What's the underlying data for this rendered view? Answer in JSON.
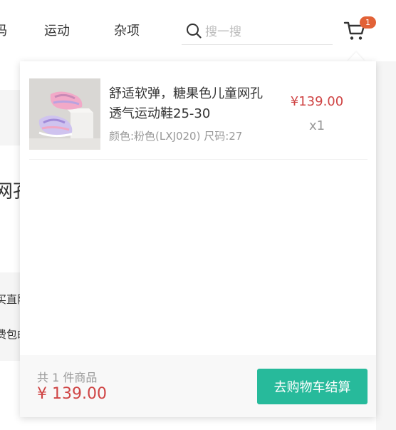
{
  "nav": {
    "items": [
      "码",
      "运动",
      "杂项"
    ]
  },
  "search": {
    "placeholder": "搜一搜",
    "icon": "search-icon"
  },
  "cart": {
    "icon": "cart-icon",
    "badge_count": "1"
  },
  "background": {
    "title_fragment": "网孔",
    "promo_line1": "买直降",
    "promo_line2": "费包邮"
  },
  "dropdown": {
    "items": [
      {
        "name": "舒适软弹，糖果色儿童网孔透气运动鞋25-30",
        "attrs": "颜色:粉色(LXJ020) 尺码:27",
        "price": "¥139.00",
        "quantity": "x1"
      }
    ],
    "footer": {
      "count_text": "共 1 件商品",
      "total": "¥ 139.00",
      "checkout_label": "去购物车结算"
    }
  },
  "colors": {
    "accent_green": "#27ba9b",
    "price_red": "#cf4444",
    "badge_orange": "#e26237"
  }
}
